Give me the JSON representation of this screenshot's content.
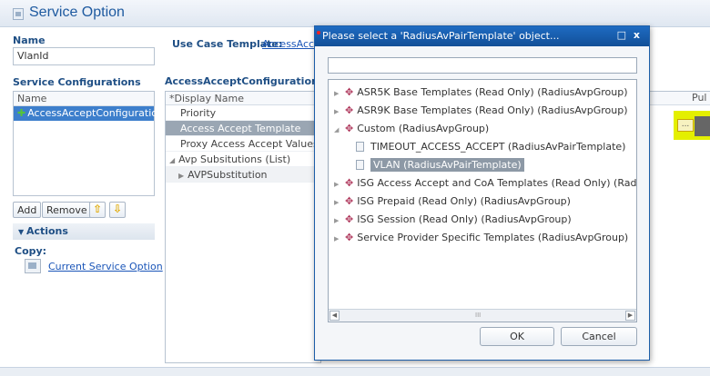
{
  "window": {
    "title": "Service Option"
  },
  "name_section": {
    "label": "Name",
    "value": "VlanId"
  },
  "use_case": {
    "label": "Use Case Template:",
    "link": "AccessAcc"
  },
  "service_configs": {
    "label": "Service Configurations",
    "column": "Name",
    "items": [
      "AccessAcceptConfiguration"
    ],
    "buttons": {
      "add": "Add",
      "remove": "Remove"
    }
  },
  "actions": {
    "header": "Actions",
    "copy_label": "Copy:",
    "link": "Current Service Option"
  },
  "properties": {
    "title": "AccessAcceptConfiguration Para",
    "header": "*Display Name",
    "rows": [
      "Priority",
      "Access Accept Template",
      "Proxy Access Accept Values",
      "Avp Subsitutions (List)",
      "AVPSubstitution"
    ],
    "right_header": "Pul",
    "ellipsis": "..."
  },
  "dialog": {
    "title": "Please select a 'RadiusAvPairTemplate' object...",
    "controls": "□ x",
    "search_value": "",
    "tree": [
      "ASR5K Base Templates (Read Only) (RadiusAvpGroup)",
      "ASR9K Base Templates (Read Only) (RadiusAvpGroup)",
      "Custom (RadiusAvpGroup)",
      "TIMEOUT_ACCESS_ACCEPT (RadiusAvPairTemplate)",
      "VLAN (RadiusAvPairTemplate)",
      "ISG Access Accept and CoA Templates (Read Only) (RadiusAvpGroup)",
      "ISG Prepaid (Read Only) (RadiusAvpGroup)",
      "ISG Session (Read Only) (RadiusAvpGroup)",
      "Service Provider Specific Templates (RadiusAvpGroup)"
    ],
    "scroll_grip": "III",
    "ok": "OK",
    "cancel": "Cancel"
  }
}
